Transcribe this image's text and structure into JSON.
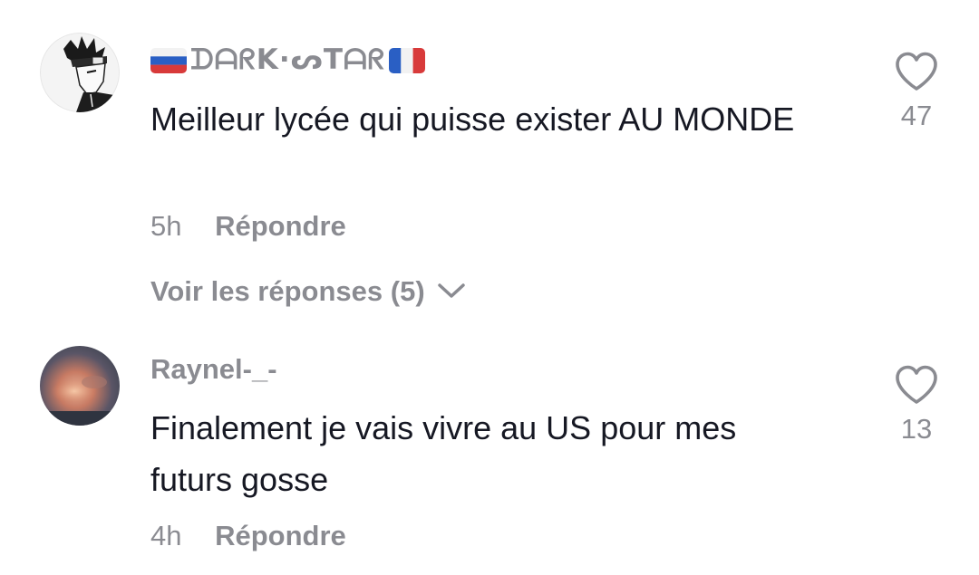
{
  "comments": [
    {
      "username_prefix_flag": "russia-flag",
      "username": "ᗪᗩᖇK·ᔕTᗩᖇ",
      "username_suffix_flag": "france-flag",
      "text": "Meilleur lycée qui puisse exister AU MONDE",
      "time": "5h",
      "reply_label": "Répondre",
      "likes": "47",
      "view_replies": "Voir les réponses (5)",
      "avatar_icon": "manga-character-avatar"
    },
    {
      "username": "Raynel-_-",
      "text": "Finalement je vais vivre au US pour mes futurs gosse",
      "time": "4h",
      "reply_label": "Répondre",
      "likes": "13",
      "avatar_icon": "sunset-cloud-avatar"
    }
  ],
  "icons": {
    "like": "heart-outline-icon",
    "expand": "chevron-down-icon"
  },
  "colors": {
    "text_primary": "#161823",
    "text_secondary": "#8a8b91",
    "background": "#ffffff"
  }
}
